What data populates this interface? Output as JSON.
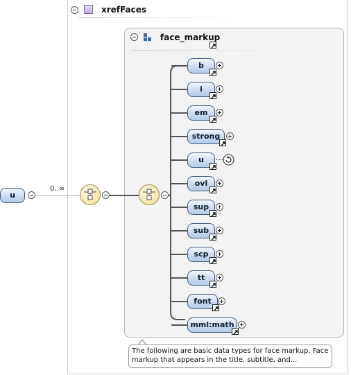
{
  "root_element": {
    "label": "u"
  },
  "occurrence": "0..∞",
  "outer_group": {
    "title": "xrefFaces"
  },
  "inner_group": {
    "title": "face_markup"
  },
  "children": [
    {
      "label": "b"
    },
    {
      "label": "i"
    },
    {
      "label": "em"
    },
    {
      "label": "strong"
    },
    {
      "label": "u",
      "recursive": true
    },
    {
      "label": "ovl"
    },
    {
      "label": "sup"
    },
    {
      "label": "sub"
    },
    {
      "label": "scp"
    },
    {
      "label": "tt"
    },
    {
      "label": "font"
    },
    {
      "label": "mml:math"
    }
  ],
  "annotation": {
    "line1": "The following are basic data types for face markup. Face",
    "line2": "markup that appears in the title, subtitle, and..."
  },
  "colors": {
    "node_fill": "#c9d9f0",
    "node_border": "#3e5a80",
    "compositor_fill": "#f5e6a6"
  }
}
